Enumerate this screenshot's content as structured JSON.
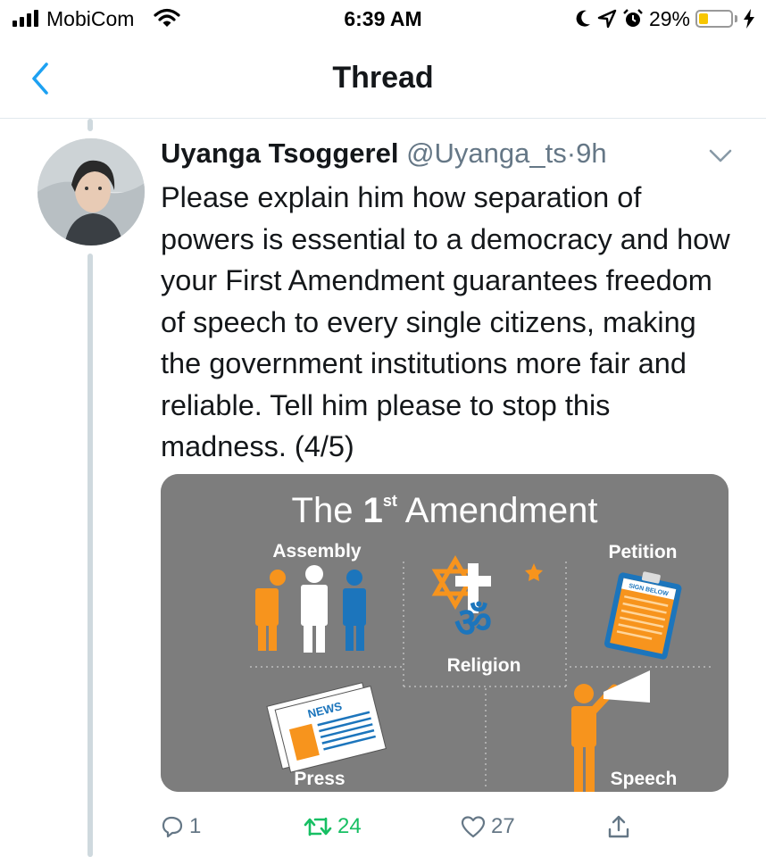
{
  "status_bar": {
    "carrier": "MobiCom",
    "time": "6:39 AM",
    "battery_percent": "29%",
    "battery_level": 0.29,
    "battery_color": "#f7c600",
    "icons": [
      "signal-bars-icon",
      "wifi-icon",
      "moon-icon",
      "location-arrow-icon",
      "alarm-icon",
      "battery-icon",
      "charging-bolt-icon"
    ]
  },
  "nav": {
    "title": "Thread",
    "back_icon": "chevron-left-icon",
    "accent": "#1da1f2"
  },
  "tweet": {
    "display_name": "Uyanga Tsoggerel",
    "handle": "@Uyanga_ts",
    "separator": "·",
    "time": "9h",
    "text": "Please explain him how separation of powers is essential to a democracy and how your First Amendment guarantees freedom of speech to every single citizens, making the government institutions more fair and reliable. Tell him please to stop this madness. (4/5)",
    "media": {
      "title_prefix": "The ",
      "title_num": "1",
      "title_sup": "st",
      "title_suffix": " Amendment",
      "labels": {
        "assembly": "Assembly",
        "religion": "Religion",
        "petition": "Petition",
        "press": "Press",
        "speech": "Speech",
        "news": "NEWS",
        "sign_below": "SIGN BELOW"
      }
    },
    "actions": {
      "replies": "1",
      "retweets": "24",
      "likes": "27"
    },
    "colors": {
      "retweet": "#17bf63",
      "muted": "#657786",
      "media_bg": "#7d7d7d",
      "orange": "#f7941d",
      "blue": "#1c75bc"
    }
  }
}
